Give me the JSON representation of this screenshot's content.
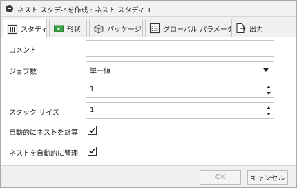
{
  "window": {
    "title": "ネスト スタディを作成 : ネスト スタディ.1"
  },
  "tabs": [
    {
      "label": "スタディ",
      "icon": "study-icon",
      "active": true
    },
    {
      "label": "形状",
      "icon": "shape-icon",
      "active": false
    },
    {
      "label": "パッケージ",
      "icon": "package-icon",
      "active": false
    },
    {
      "label": "グローバル パラメータ",
      "icon": "global-parameters-icon",
      "active": false
    },
    {
      "label": "出力",
      "icon": "output-icon",
      "active": false
    }
  ],
  "form": {
    "comment": {
      "label": "コメント",
      "value": ""
    },
    "jobs": {
      "label": "ジョブ数",
      "mode": "単一値",
      "count": "1"
    },
    "stack_size": {
      "label": "スタック サイズ",
      "value": "1"
    },
    "auto_nest": {
      "label": "自動的にネストを計算",
      "checked": true
    },
    "auto_manage": {
      "label": "ネストを自動的に管理",
      "checked": true
    }
  },
  "footer": {
    "ok_label": "OK",
    "cancel_label": "キャンセル",
    "ok_enabled": false
  },
  "colors": {
    "tab_green": "#3aa346",
    "accent_dark": "#3c3c3c"
  }
}
